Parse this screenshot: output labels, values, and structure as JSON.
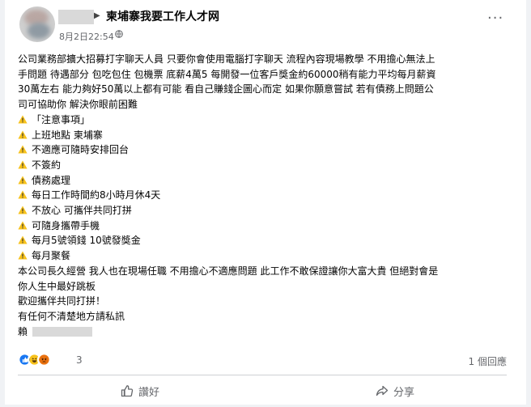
{
  "post": {
    "group_name": "柬埔寨我要工作人才网",
    "time": "8月2日22:54",
    "body_lines": [
      "公司業務部擴大招募打字聊天人員 只要你會使用電腦打字聊天 流程內容現場教學 不用擔心無法上",
      "手問題 待遇部分 包吃包住 包機票 底薪4萬5 每開發一位客戶獎金約60000稍有能力平均每月薪資",
      "30萬左右 能力夠好50萬以上都有可能 看自己賺錢企圖心而定 如果你願意嘗試 若有債務上問題公",
      "司可協助你 解決你眼前困難"
    ],
    "list_items": [
      "「注意事項」",
      "上班地點 柬埔寨",
      "不適應可隨時安排回台",
      "不簽約",
      "債務處理",
      "每日工作時間約8小時月休4天",
      "不放心 可攜伴共同打拼",
      "可隨身攜帶手機",
      "每月5號領錢 10號發獎金",
      "每月聚餐"
    ],
    "closing_lines": [
      "本公司長久經營 我人也在現場任職 不用擔心不適應問題 此工作不敢保證讓你大富大貴 但絕對會是",
      "你人生中最好跳板",
      "歡迎攜伴共同打拼！",
      "有任何不清楚地方請私訊"
    ],
    "contact_prefix": "賴"
  },
  "reactions": {
    "count": "3",
    "comments": "1 個回應",
    "icons": [
      "like-icon",
      "haha-icon",
      "angry-icon"
    ]
  },
  "actions": {
    "like_label": "讚好",
    "share_label": "分享"
  },
  "colors": {
    "text": "#050505",
    "secondary": "#65676b",
    "like_blue": "#1877f2",
    "warn_yellow": "#f7c21b"
  }
}
